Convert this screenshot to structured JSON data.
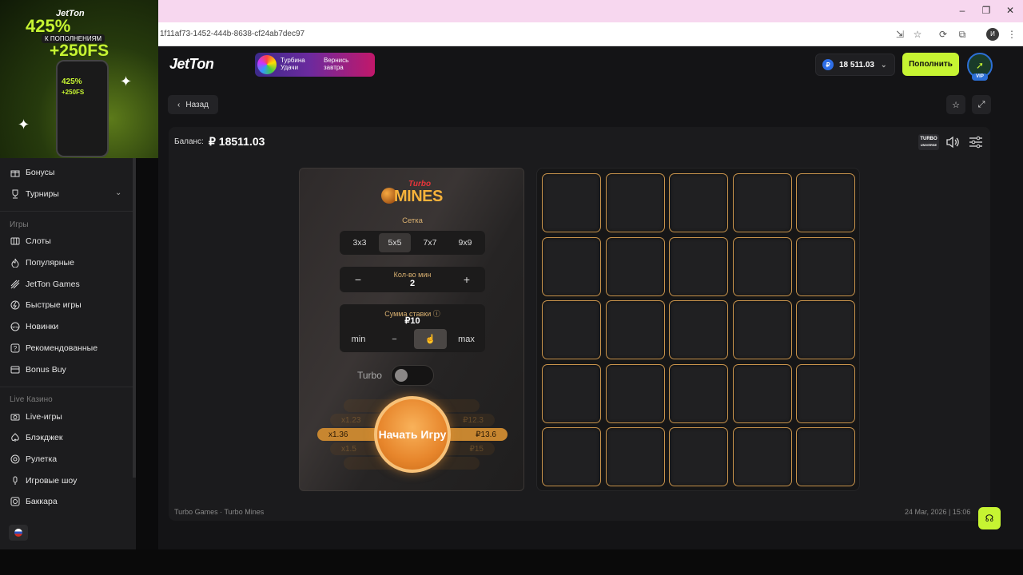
{
  "browser": {
    "url": "1f11af73-1452-444b-8638-cf24ab7dec97",
    "profile_initial": "И"
  },
  "ad": {
    "logo": "JetTon",
    "percent": "425%",
    "subtitle": "К ПОПОЛНЕНИЯМ",
    "freespins": "+250FS",
    "phone_line1": "425%",
    "phone_line2": "+250FS"
  },
  "sidebar": {
    "top_items": [
      {
        "label": "Бонусы",
        "icon": "gift-icon"
      },
      {
        "label": "Турниры",
        "icon": "trophy-icon"
      }
    ],
    "games_heading": "Игры",
    "game_items": [
      {
        "label": "Слоты",
        "icon": "slots-icon"
      },
      {
        "label": "Популярные",
        "icon": "fire-icon"
      },
      {
        "label": "JetTon Games",
        "icon": "jet-icon"
      },
      {
        "label": "Быстрые игры",
        "icon": "lightning-icon"
      },
      {
        "label": "Новинки",
        "icon": "new-badge-icon"
      },
      {
        "label": "Рекомендованные",
        "icon": "recommended-icon"
      },
      {
        "label": "Bonus Buy",
        "icon": "wallet-icon"
      }
    ],
    "live_heading": "Live Казино",
    "live_items": [
      {
        "label": "Live-игры",
        "icon": "camera-icon"
      },
      {
        "label": "Блэкджек",
        "icon": "spade-icon"
      },
      {
        "label": "Рулетка",
        "icon": "roulette-icon"
      },
      {
        "label": "Игровые шоу",
        "icon": "microphone-icon"
      },
      {
        "label": "Баккара",
        "icon": "chip-icon"
      }
    ]
  },
  "header": {
    "logo": "JetTon",
    "promo_title": "Турбина Удачи",
    "promo_cta": "Вернись завтра",
    "currency_symbol": "₽",
    "balance": "18 511.03",
    "deposit_label": "Пополнить",
    "vip_label": "VIP"
  },
  "nav": {
    "back_label": "Назад"
  },
  "game": {
    "balance_label": "Баланс:",
    "balance_value": "₽ 18511.03",
    "brand_top": "TURBO",
    "brand_bottom": "UNIVERSE",
    "title_turbo": "Turbo",
    "title_mines": "MINES",
    "grid_label": "Сетка",
    "grid_options": [
      "3x3",
      "5x5",
      "7x7",
      "9x9"
    ],
    "grid_selected": "5x5",
    "mines_label": "Кол-во мин",
    "mines_count": "2",
    "bet_label": "Сумма ставки ⓘ",
    "bet_value": "₽10",
    "bet_min": "min",
    "bet_minus": "−",
    "bet_max": "max",
    "turbo_label": "Turbo",
    "turbo_on": false,
    "multiplier_main": "x1.36",
    "payout_main": "₽13.6",
    "multiplier_above": "x1.23",
    "payout_above": "₽12.3",
    "multiplier_below": "x1.5",
    "payout_below": "₽15",
    "start_label": "Начать Игру",
    "grid_size": 5,
    "footer_left": "Turbo Games · Turbo Mines",
    "footer_right": "24 Mar, 2026 | 15:06"
  },
  "colors": {
    "accent": "#c6f432",
    "cell_border": "#c9944c",
    "start_button": "#e7862c"
  }
}
